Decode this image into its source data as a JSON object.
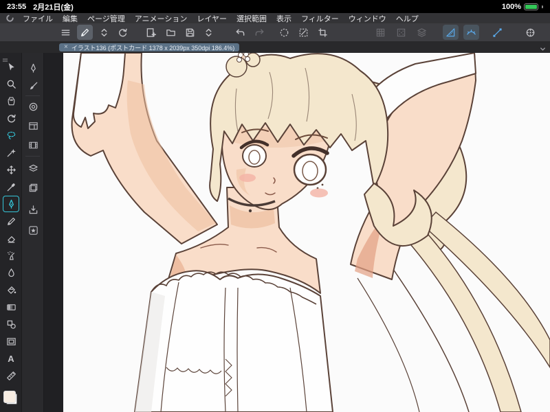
{
  "status_bar": {
    "time": "23:55",
    "date": "2月21日(金)",
    "battery_percent": "100%"
  },
  "menu_bar": {
    "items": [
      "ファイル",
      "編集",
      "ページ管理",
      "アニメーション",
      "レイヤー",
      "選択範囲",
      "表示",
      "フィルター",
      "ウィンドウ",
      "ヘルプ"
    ]
  },
  "command_bar": {
    "icons": [
      {
        "name": "menu"
      },
      {
        "name": "workspace-edit",
        "state": "pressed"
      },
      {
        "name": "collapse-toggle"
      },
      {
        "name": "rotate-reset"
      },
      {
        "name": "new-canvas"
      },
      {
        "name": "open-file"
      },
      {
        "name": "save-file"
      },
      {
        "name": "panel-toggle"
      },
      {
        "name": "undo"
      },
      {
        "name": "redo",
        "state": "disabled"
      },
      {
        "name": "selection-launcher"
      },
      {
        "name": "deselect"
      },
      {
        "name": "crop-mark"
      },
      {
        "name": "grid",
        "state": "disabled"
      },
      {
        "name": "screentone",
        "state": "disabled"
      },
      {
        "name": "material",
        "state": "disabled"
      },
      {
        "name": "snap-linear-ruler",
        "state": "active"
      },
      {
        "name": "snap-special-ruler",
        "state": "active"
      },
      {
        "name": "vector-snap",
        "state": "active"
      },
      {
        "name": "quick-access-dial"
      }
    ]
  },
  "document_tab": {
    "close_glyph": "×",
    "title": "イラスト136 (ポストカード 1378 x 2039px 350dpi 186.4%)"
  },
  "tool_bar": {
    "tools": [
      {
        "name": "operation"
      },
      {
        "name": "zoom"
      },
      {
        "name": "hand"
      },
      {
        "name": "rotate-canvas"
      },
      {
        "name": "lasso-select",
        "highlight": "cyan"
      },
      {
        "name": "auto-select"
      },
      {
        "name": "move-layer"
      },
      {
        "name": "eyedropper"
      },
      {
        "name": "pen",
        "state": "active"
      },
      {
        "name": "pencil"
      },
      {
        "name": "eraser"
      },
      {
        "name": "airbrush"
      },
      {
        "name": "blend"
      },
      {
        "name": "fill"
      },
      {
        "name": "gradient"
      },
      {
        "name": "figure"
      },
      {
        "name": "frame-border"
      },
      {
        "name": "text",
        "glyph": "A"
      },
      {
        "name": "ruler"
      }
    ],
    "current_color": "#f6ece2"
  },
  "palette_dock": {
    "icons": [
      {
        "name": "sub-tool"
      },
      {
        "name": "brush-settings"
      },
      {
        "name": "color-wheel"
      },
      {
        "name": "navigator"
      },
      {
        "name": "timeline"
      },
      {
        "name": "layer-property"
      },
      {
        "name": "layers"
      },
      {
        "name": "import"
      },
      {
        "name": "favorites"
      }
    ]
  },
  "canvas": {
    "artwork": "anime-style bride character in white dress, arms raised behind head",
    "palette": {
      "line": "#5a4238",
      "hair": "#f4e7cd",
      "skin": "#f9ddc9",
      "skin_shadow": "#eebf9f",
      "blush": "#f4b3a5",
      "dress": "#fefefe",
      "background": "#fbfbfb"
    }
  },
  "colors": {
    "accent_blue": "#5aa9ea",
    "tool_active_teal": "#35c6d9",
    "tab_chip": "#5b7186",
    "status_green": "#34c759"
  }
}
